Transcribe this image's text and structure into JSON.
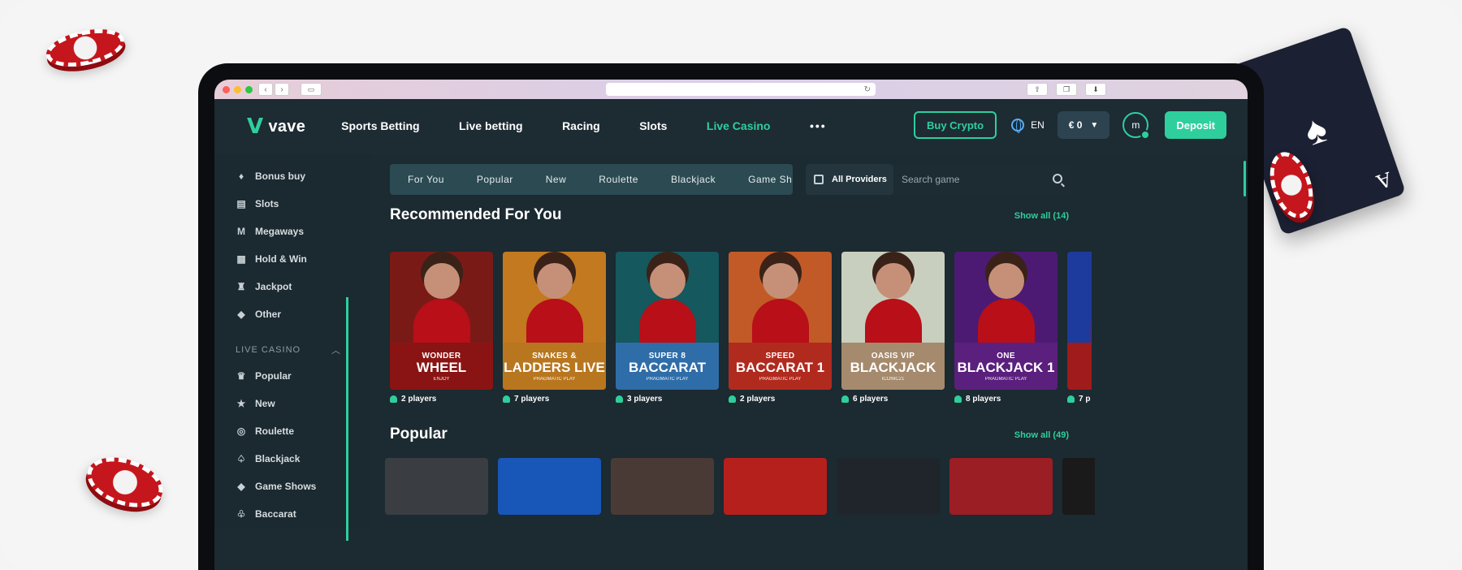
{
  "browser": {
    "url": ""
  },
  "site": {
    "logo": "vave",
    "nav": [
      {
        "label": "Sports Betting",
        "active": false
      },
      {
        "label": "Live betting",
        "active": false
      },
      {
        "label": "Racing",
        "active": false
      },
      {
        "label": "Slots",
        "active": false
      },
      {
        "label": "Live Casino",
        "active": true
      }
    ],
    "more": "•••",
    "buy_crypto": "Buy Crypto",
    "language": "EN",
    "balance": "€ 0",
    "avatar_initial": "m",
    "deposit": "Deposit"
  },
  "sidebar": {
    "items_top": [
      "Bonus buy",
      "Slots",
      "Megaways",
      "Hold & Win",
      "Jackpot",
      "Other"
    ],
    "section": "LIVE CASINO",
    "items_live": [
      "Popular",
      "New",
      "Roulette",
      "Blackjack",
      "Game Shows",
      "Baccarat"
    ]
  },
  "categories": [
    "For You",
    "Popular",
    "New",
    "Roulette",
    "Blackjack",
    "Game Sh"
  ],
  "providers_label": "All Providers",
  "search_placeholder": "Search game",
  "recommended": {
    "title": "Recommended For You",
    "show_all": "Show all (14)",
    "games": [
      {
        "top": "WONDER",
        "name": "WHEEL",
        "provider": "ENJOY",
        "players": "2 players",
        "bg": "#7a1a17",
        "label_bg": "#8a1414"
      },
      {
        "top": "SNAKES &",
        "name": "LADDERS LIVE",
        "provider": "PRAGMATIC PLAY",
        "players": "7 players",
        "bg": "#c2791f",
        "label_bg": "#b8761e"
      },
      {
        "top": "SUPER 8",
        "name": "BACCARAT",
        "provider": "PRAGMATIC PLAY",
        "players": "3 players",
        "bg": "#15585e",
        "label_bg": "#2f6da8"
      },
      {
        "top": "SPEED",
        "name": "BACCARAT 1",
        "provider": "PRAGMATIC PLAY",
        "players": "2 players",
        "bg": "#c25a27",
        "label_bg": "#b12a1e"
      },
      {
        "top": "OASIS VIP",
        "name": "BLACKJACK",
        "provider": "ICONIC21",
        "players": "6 players",
        "bg": "#c9cfbf",
        "label_bg": "#a58a6d"
      },
      {
        "top": "ONE",
        "name": "BLACKJACK 1",
        "provider": "PRAGMATIC PLAY",
        "players": "8 players",
        "bg": "#4d1a73",
        "label_bg": "#5b1f7e"
      },
      {
        "top": "",
        "name": "",
        "provider": "",
        "players": "7 p",
        "bg": "#1c3b9c",
        "label_bg": "#a01b1b"
      }
    ]
  },
  "popular": {
    "title": "Popular",
    "show_all": "Show all (49)",
    "tiles": [
      "#3a3e42",
      "#1856b8",
      "#4a3a36",
      "#b5201c",
      "#20252c",
      "#9a1e24",
      "#1a1a1a"
    ]
  }
}
